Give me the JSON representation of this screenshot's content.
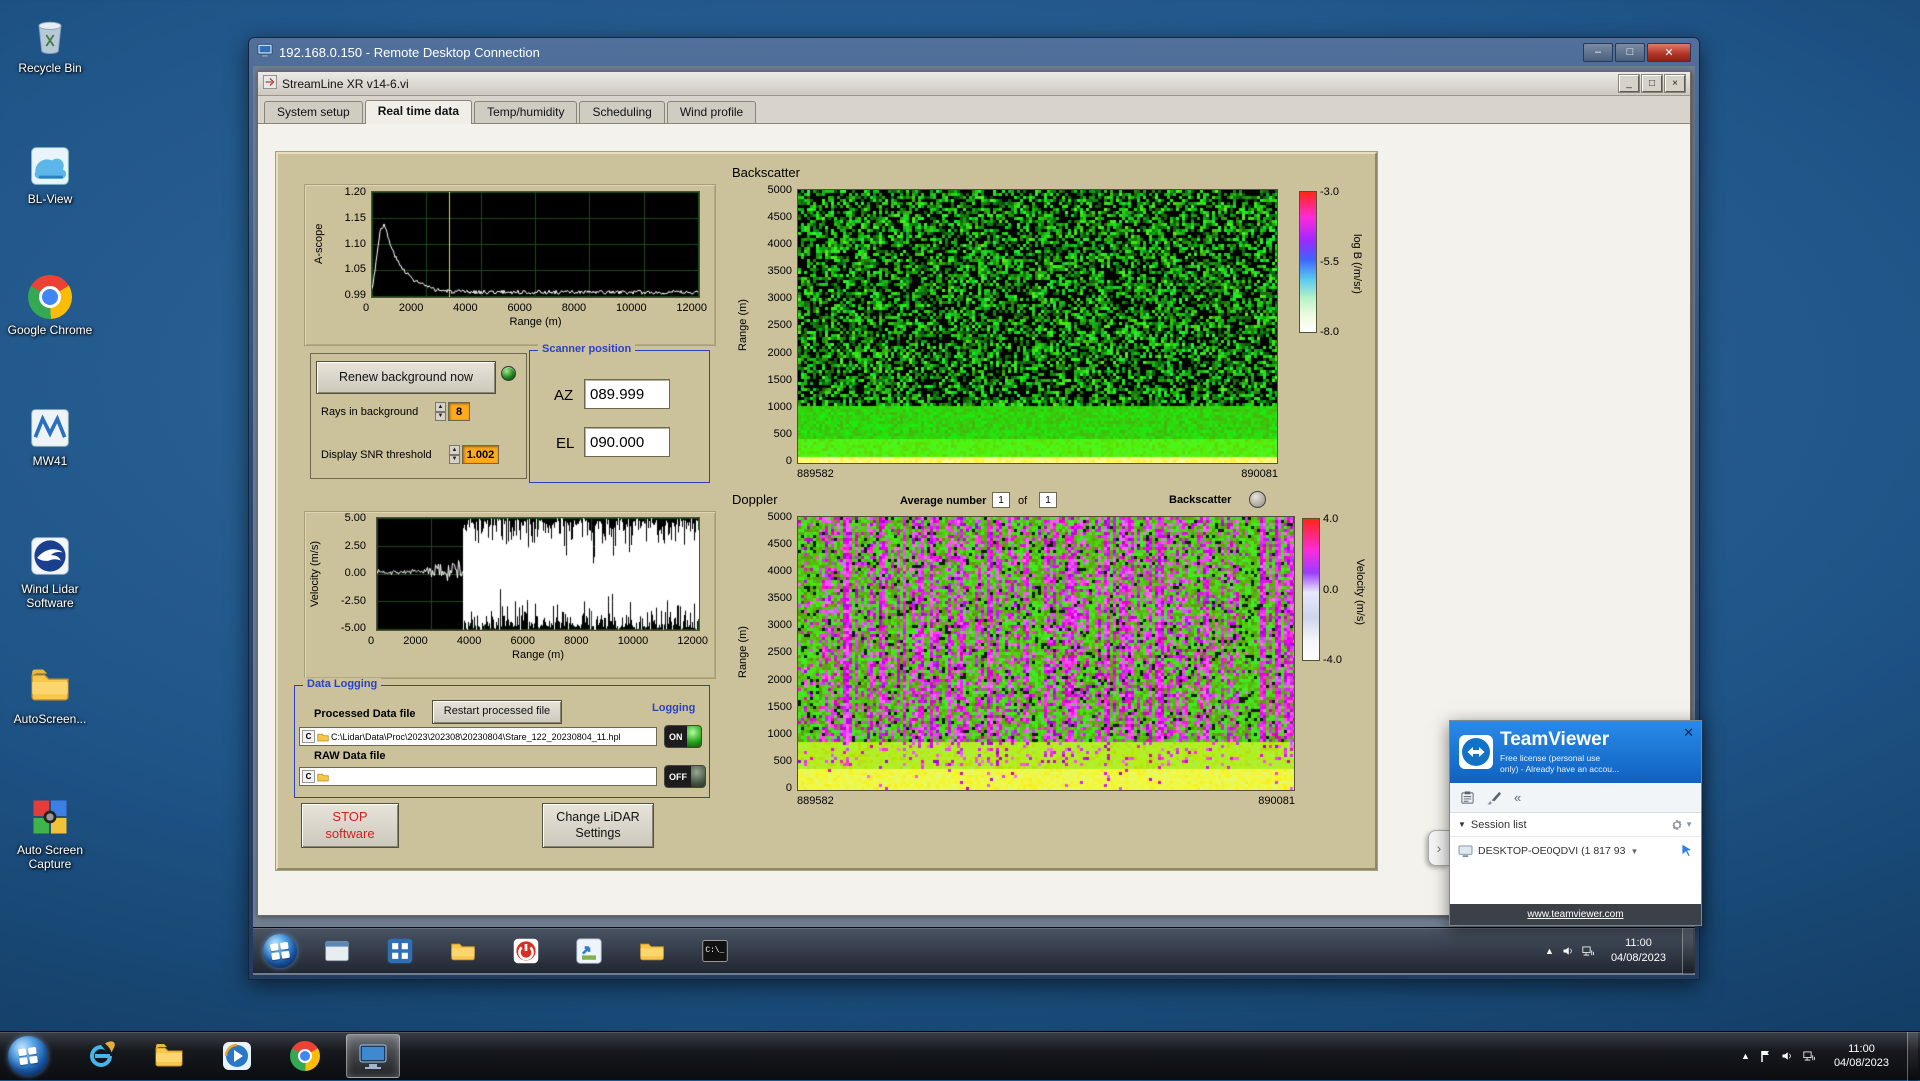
{
  "desktop": {
    "icons": [
      {
        "label": "Recycle Bin",
        "icon": "recycle-bin-icon"
      },
      {
        "label": "BL-View",
        "icon": "bl-view-icon"
      },
      {
        "label": "Google Chrome",
        "icon": "chrome-icon"
      },
      {
        "label": "MW41",
        "icon": "mw41-icon"
      },
      {
        "label": "Wind Lidar Software",
        "icon": "wind-lidar-icon"
      },
      {
        "label": "AutoScreen...",
        "icon": "folder-icon"
      },
      {
        "label": "Auto Screen Capture",
        "icon": "screen-capture-icon"
      }
    ]
  },
  "rdp_window": {
    "title": "192.168.0.150 - Remote Desktop Connection"
  },
  "app_window": {
    "title": "StreamLine XR v14-6.vi",
    "tabs": [
      {
        "label": "System setup",
        "active": false
      },
      {
        "label": "Real time data",
        "active": true
      },
      {
        "label": "Temp/humidity",
        "active": false
      },
      {
        "label": "Scheduling",
        "active": false
      },
      {
        "label": "Wind profile",
        "active": false
      }
    ]
  },
  "controls": {
    "renew_background_label": "Renew background now",
    "rays_label": "Rays in background",
    "rays_value": "8",
    "snr_label": "Display SNR threshold",
    "snr_value": "1.002",
    "scanner": {
      "title": "Scanner position",
      "az_label": "AZ",
      "az_value": "089.999",
      "el_label": "EL",
      "el_value": "090.000"
    },
    "average_label": "Average number",
    "average_value": "1",
    "of_label": "of",
    "average_total": "1",
    "backscatter_toggle_label": "Backscatter",
    "stop_button": "STOP software",
    "change_settings_button": "Change LiDAR Settings"
  },
  "data_logging": {
    "title": "Data Logging",
    "processed_label": "Processed Data file",
    "restart_button": "Restart processed file",
    "logging_label": "Logging",
    "processed_path": "C:\\Lidar\\Data\\Proc\\2023\\202308\\20230804\\Stare_122_20230804_11.hpl",
    "processed_state": "ON",
    "raw_label": "RAW Data file",
    "raw_path": "",
    "raw_state": "OFF"
  },
  "chart_data": [
    {
      "id": "ascope",
      "type": "line",
      "ylabel": "A-scope",
      "xlabel": "Range (m)",
      "xlim": [
        0,
        12000
      ],
      "ylim": [
        0.99,
        1.2
      ],
      "xticks": [
        "0",
        "2000",
        "4000",
        "6000",
        "8000",
        "10000",
        "12000"
      ],
      "yticks": [
        "1.20",
        "1.15",
        "1.10",
        "1.05",
        "0.99"
      ],
      "cursor_x": 2830,
      "anchors": [
        [
          0,
          1.005
        ],
        [
          150,
          1.06
        ],
        [
          300,
          1.125
        ],
        [
          450,
          1.135
        ],
        [
          700,
          1.09
        ],
        [
          1000,
          1.055
        ],
        [
          1500,
          1.025
        ],
        [
          2200,
          1.006
        ],
        [
          3000,
          1.0
        ],
        [
          12000,
          0.999
        ]
      ],
      "noise_amp": 0.004,
      "seed": 3,
      "line_color": "#ffffff",
      "cursor_color": "#e8d44d",
      "grid_color": "#1e4a1e",
      "bg": "#000000"
    },
    {
      "id": "backscatter_map",
      "type": "heatmap",
      "title": "Backscatter",
      "ylabel": "Range (m)",
      "ylim": [
        0,
        5000
      ],
      "yticks": [
        "5000",
        "4500",
        "4000",
        "3500",
        "3000",
        "2500",
        "2000",
        "1500",
        "1000",
        "500",
        "0"
      ],
      "x_start": "889582",
      "x_end": "890081",
      "colorbar": {
        "label": "log B (/m/sr)",
        "ticks": [
          "-3.0",
          "-5.5",
          "-8.0"
        ]
      },
      "bands": [
        {
          "range_m": [
            0,
            110
          ],
          "desc": "bright yellow surface return band"
        },
        {
          "range_m": [
            110,
            1050
          ],
          "desc": "solid bright green backscatter"
        },
        {
          "range_m": [
            1050,
            5000
          ],
          "desc": "green/black speckle noise"
        }
      ],
      "seed": 42
    },
    {
      "id": "velocity",
      "type": "line",
      "ylabel": "Velocity (m/s)",
      "xlabel": "Range (m)",
      "xlim": [
        0,
        12000
      ],
      "ylim": [
        -5,
        5
      ],
      "xticks": [
        "0",
        "2000",
        "4000",
        "6000",
        "8000",
        "10000",
        "12000"
      ],
      "yticks": [
        "5.00",
        "2.50",
        "0.00",
        "-2.50",
        "-5.00"
      ],
      "regions": [
        {
          "x": [
            0,
            1800
          ],
          "amp": 0.28,
          "base": 0.18
        },
        {
          "x": [
            1800,
            3200
          ],
          "amp": 1.7,
          "base": 0.3,
          "ramp": true
        },
        {
          "x": [
            3200,
            12000
          ],
          "amp": 5,
          "base": 0
        }
      ],
      "seed": 7,
      "line_color": "#ffffff",
      "grid_color": "#1e4a1e",
      "bg": "#000000"
    },
    {
      "id": "doppler_map",
      "type": "heatmap",
      "title": "Doppler",
      "ylabel": "Range (m)",
      "ylim": [
        0,
        5000
      ],
      "yticks": [
        "5000",
        "4500",
        "4000",
        "3500",
        "3000",
        "2500",
        "2000",
        "1500",
        "1000",
        "500",
        "0"
      ],
      "x_start": "889582",
      "x_end": "890081",
      "colorbar": {
        "label": "Velocity (m/s)",
        "ticks": [
          "4.0",
          "0.0",
          "-4.0"
        ]
      },
      "bands": [
        {
          "range_m": [
            0,
            450
          ],
          "desc": "yellow band near ground"
        },
        {
          "range_m": [
            450,
            900
          ],
          "desc": "yellow-green transition"
        },
        {
          "range_m": [
            900,
            5000
          ],
          "desc": "green noise with vertical magenta/purple streaks"
        }
      ],
      "seed": 99
    }
  ],
  "teamviewer": {
    "title": "TeamViewer",
    "subtitle_line1": "Free license (personal use",
    "subtitle_line2": "only) - Already have an accou...",
    "session_list_label": "Session list",
    "computer_name": "DESKTOP-OE0QDVI (1 817 93",
    "footer_link": "www.teamviewer.com"
  },
  "remote_taskbar": {
    "time": "11:00",
    "date": "04/08/2023",
    "icons": [
      "start-orb",
      "window-icon",
      "grid-app-icon",
      "folder-icon",
      "power-app-icon",
      "updater-app-icon",
      "folder-icon",
      "command-prompt-icon"
    ]
  },
  "taskbar": {
    "time": "11:00",
    "date": "04/08/2023",
    "icons": [
      "start-orb",
      "internet-explorer-icon",
      "explorer-folder-icon",
      "media-player-icon",
      "chrome-icon",
      "remote-desktop-icon"
    ]
  }
}
